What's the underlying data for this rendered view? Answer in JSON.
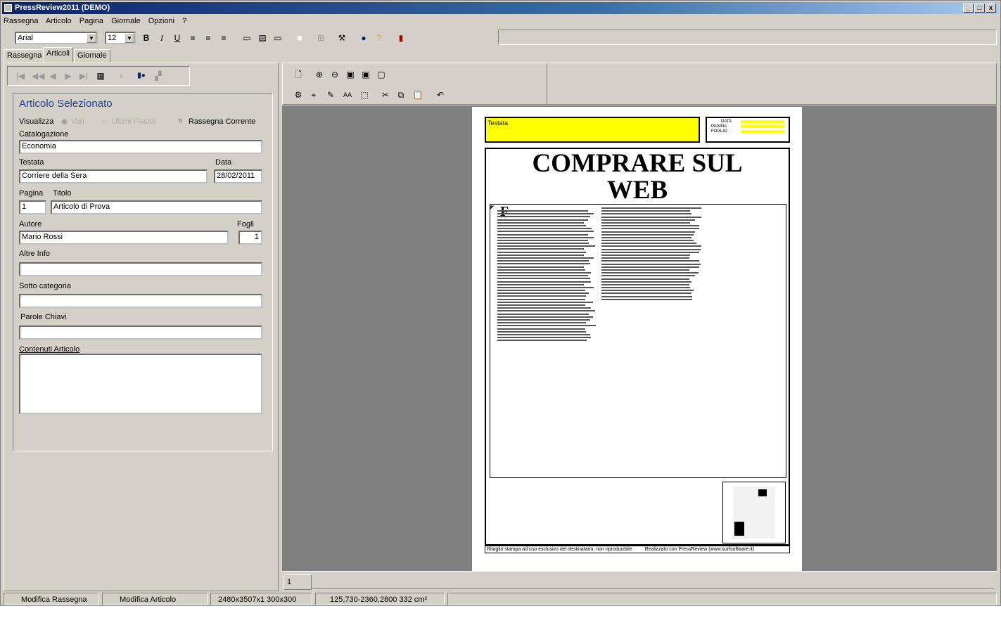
{
  "window": {
    "title": "PressReview2011 (DEMO)",
    "controls": [
      "_",
      "□",
      "x"
    ]
  },
  "menu": [
    "Rassegna",
    "Articolo",
    "Pagina",
    "Giornale",
    "Opzioni",
    "?"
  ],
  "format_toolbar": {
    "font": "Arial",
    "size": "12",
    "bold": "B",
    "italic": "I",
    "underline": "U"
  },
  "tabs": [
    "Rassegna",
    "Articoli",
    "Giornale"
  ],
  "panel": {
    "heading": "Articolo Selezionato",
    "visualizza_label": "Visualizza",
    "radio": [
      "Vari",
      "Ultimi Fissati",
      "Rassegna Corrente"
    ],
    "catalogazione": {
      "label": "Catalogazione",
      "value": "Economia"
    },
    "testata": {
      "label": "Testata",
      "value": "Corriere della Sera"
    },
    "data": {
      "label": "Data",
      "value": "28/02/2011"
    },
    "pagina": {
      "label": "Pagina",
      "value": "1"
    },
    "titolo": {
      "label": "Titolo",
      "value": "Articolo di Prova"
    },
    "autore": {
      "label": "Autore",
      "value": "Mario Rossi"
    },
    "fogli": {
      "label": "Fogli",
      "value": "1"
    },
    "altre_info": {
      "label": "Altre Info",
      "value": ""
    },
    "sotto_categoria": {
      "label": "Sotto categoria",
      "value": ""
    },
    "parole_chiavi": {
      "label": "Parole Chiavi",
      "value": ""
    },
    "contenuti": {
      "label": "Contenuti Articolo",
      "value": ""
    }
  },
  "document": {
    "testata_box": "Testata",
    "meta_labels": [
      "DATA",
      "PAGINA",
      "FOGLIO"
    ],
    "headline_line1": "COMPRARE SUL",
    "headline_line2": "WEB",
    "drop_cap": "F",
    "footer_left": "Ritaglio stampa ad uso esclusivo del destinatario, non riproducibile",
    "footer_right": "Realizzato con PressReview (www.surfsoftware.it)"
  },
  "page_tab": "1",
  "statusbar": [
    "Modifica Rassegna",
    "Modifica Articolo",
    "2480x3507x1 300x300",
    "125,730-2360,2800 332 cm²"
  ],
  "colors": {
    "titlebar": "#0a246a",
    "chrome": "#d4d0c8",
    "viewer_bg": "#808080",
    "highlight": "#ffff00",
    "heading": "#1e3f8c"
  }
}
